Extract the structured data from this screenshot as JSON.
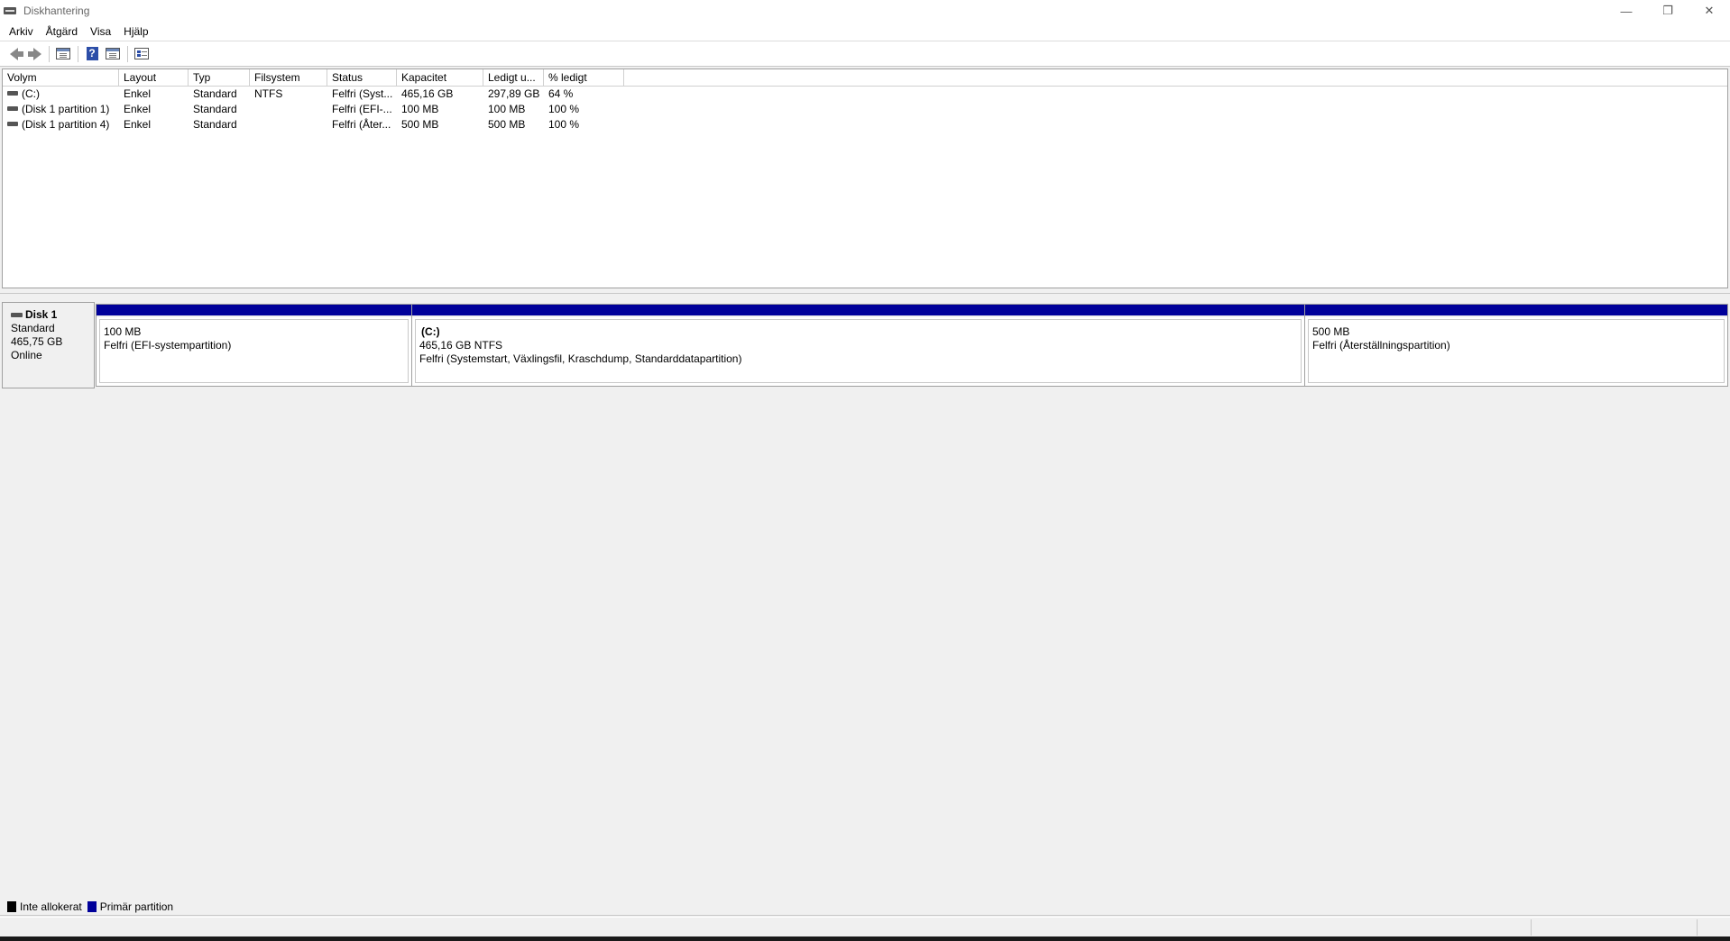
{
  "window": {
    "title": "Diskhantering",
    "minimize": "—",
    "restore": "❐",
    "close": "✕"
  },
  "menu": [
    "Arkiv",
    "Åtgärd",
    "Visa",
    "Hjälp"
  ],
  "toolbar": {
    "help_glyph": "?"
  },
  "volume_table": {
    "columns": [
      "Volym",
      "Layout",
      "Typ",
      "Filsystem",
      "Status",
      "Kapacitet",
      "Ledigt u...",
      "% ledigt"
    ],
    "rows": [
      [
        "(C:)",
        "Enkel",
        "Standard",
        "NTFS",
        "Felfri (Syst...",
        "465,16 GB",
        "297,89 GB",
        "64 %"
      ],
      [
        "(Disk 1 partition 1)",
        "Enkel",
        "Standard",
        "",
        "Felfri (EFI-...",
        "100 MB",
        "100 MB",
        "100 %"
      ],
      [
        "(Disk 1 partition 4)",
        "Enkel",
        "Standard",
        "",
        "Felfri (Åter...",
        "500 MB",
        "500 MB",
        "100 %"
      ]
    ]
  },
  "disk": {
    "name": "Disk 1",
    "type": "Standard",
    "size": "465,75 GB",
    "state": "Online",
    "partitions": [
      {
        "name": "",
        "size": "100 MB",
        "status": "Felfri (EFI-systempartition)"
      },
      {
        "name": "(C:)",
        "size": "465,16 GB NTFS",
        "status": "Felfri (Systemstart, Växlingsfil, Kraschdump, Standarddatapartition)"
      },
      {
        "name": "",
        "size": "500 MB",
        "status": "Felfri (Återställningspartition)"
      }
    ]
  },
  "legend": [
    {
      "label": "Inte allokerat",
      "color": "#000000"
    },
    {
      "label": "Primär partition",
      "color": "#00009a"
    }
  ],
  "colors": {
    "primary_partition": "#00009a"
  }
}
